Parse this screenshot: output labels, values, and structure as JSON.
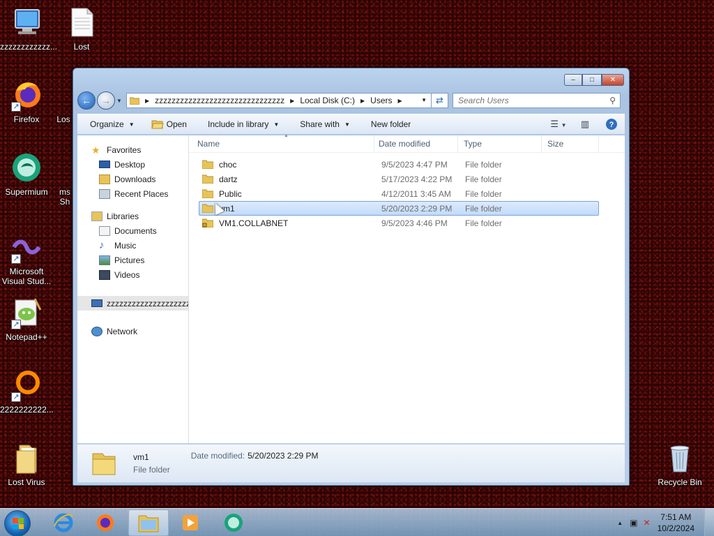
{
  "desktop": {
    "icons": [
      {
        "label": "zzzzzzzzzzzz..."
      },
      {
        "label": "Lost"
      },
      {
        "label": "Firefox"
      },
      {
        "label": "Los"
      },
      {
        "label": "Supermium"
      },
      {
        "label": "ms"
      },
      {
        "label": "Sh"
      },
      {
        "label": "Microsoft Visual Stud..."
      },
      {
        "label": "Notepad++"
      },
      {
        "label": "2222222222..."
      },
      {
        "label": "Lost Virus"
      },
      {
        "label": "Recycle Bin"
      }
    ]
  },
  "window": {
    "controls": {
      "minimize": "–",
      "maximize": "□",
      "close": "✕"
    },
    "address": {
      "parts": [
        "zzzzzzzzzzzzzzzzzzzzzzzzzzzzzzz",
        "Local Disk (C:)",
        "Users"
      ]
    },
    "search": {
      "placeholder": "Search Users"
    },
    "toolbar": {
      "organize": "Organize",
      "open": "Open",
      "include_in_library": "Include in library",
      "share_with": "Share with",
      "new_folder": "New folder"
    },
    "nav_pane": {
      "favorites": "Favorites",
      "desktop": "Desktop",
      "downloads": "Downloads",
      "recent_places": "Recent Places",
      "libraries": "Libraries",
      "documents": "Documents",
      "music": "Music",
      "pictures": "Pictures",
      "videos": "Videos",
      "computer": "zzzzzzzzzzzzzzzzzzzzzzzzzzz",
      "network": "Network"
    },
    "columns": {
      "name": "Name",
      "date_modified": "Date modified",
      "type": "Type",
      "size": "Size"
    },
    "files": [
      {
        "name": "choc",
        "date": "9/5/2023 4:47 PM",
        "type": "File folder"
      },
      {
        "name": "dartz",
        "date": "5/17/2023 4:22 PM",
        "type": "File folder"
      },
      {
        "name": "Public",
        "date": "4/12/2011 3:45 AM",
        "type": "File folder"
      },
      {
        "name": "vm1",
        "date": "5/20/2023 2:29 PM",
        "type": "File folder"
      },
      {
        "name": "VM1.COLLABNET",
        "date": "9/5/2023 4:46 PM",
        "type": "File folder"
      }
    ],
    "selected_index": 3,
    "details": {
      "name": "vm1",
      "type": "File folder",
      "date_label": "Date modified:",
      "date_value": "5/20/2023 2:29 PM"
    }
  },
  "taskbar": {
    "apps": [
      "internet-explorer",
      "firefox",
      "windows-explorer",
      "media-player",
      "supermium"
    ],
    "active_app": "windows-explorer",
    "clock": {
      "time": "7:51 AM",
      "date": "10/2/2024"
    }
  },
  "colors": {
    "selection": "#c1dbfc",
    "window_frame": "#bcd4ee",
    "desktop_bg": "#2a0505"
  }
}
